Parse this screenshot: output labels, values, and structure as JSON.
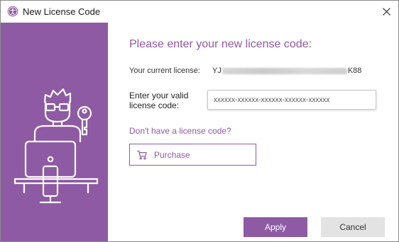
{
  "window": {
    "title": "New License Code"
  },
  "icons": {
    "app": "accessibility-person-icon",
    "close": "close-icon",
    "illustration": "person-at-computer-with-key-illustration",
    "purchase": "shopping-cart-icon"
  },
  "colors": {
    "accent": "#8e5aa3",
    "sidebar": "#8e5aa3",
    "cancel_bg": "#e3e3e3"
  },
  "main": {
    "heading": "Please enter your new license code:",
    "current_license_label": "Your current license:",
    "current_license_prefix": "YJ",
    "current_license_suffix": "K88",
    "enter_label": "Enter your valid license code:",
    "code_placeholder": "xxxxxx-xxxxxx-xxxxxx-xxxxxx-xxxxxx",
    "code_value": "",
    "no_license_link": "Don't have a license code?",
    "purchase_label": "Purchase"
  },
  "buttons": {
    "apply": "Apply",
    "cancel": "Cancel"
  }
}
